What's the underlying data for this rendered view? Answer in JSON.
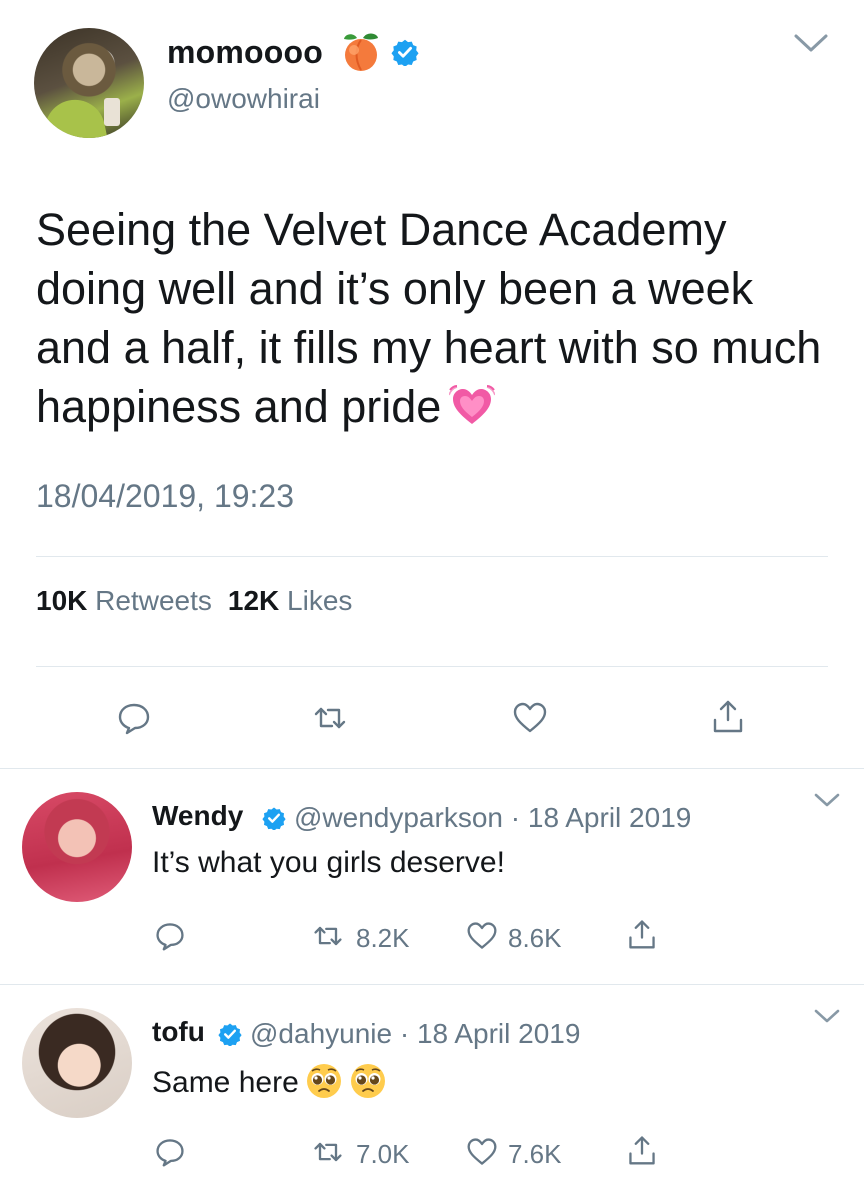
{
  "main_tweet": {
    "display_name": "momoooo",
    "name_emoji": "peach-emoji",
    "handle": "@owowhirai",
    "text": "Seeing the Velvet Dance Academy doing well and it’s only been a week and a half, it fills my heart with so much happiness and pride",
    "text_emoji": "growing-heart-emoji",
    "timestamp": "18/04/2019, 19:23",
    "retweets_count": "10K",
    "retweets_label": "Retweets",
    "likes_count": "12K",
    "likes_label": "Likes",
    "actions": [
      "reply-icon",
      "retweet-icon",
      "like-icon",
      "share-icon"
    ]
  },
  "replies": [
    {
      "display_name": "Wendy",
      "handle": "@wendyparkson",
      "separator": "·",
      "date": "18 April 2019",
      "text": "It’s what you girls deserve!",
      "retweets": "8.2K",
      "likes": "8.6K"
    },
    {
      "display_name": "tofu",
      "handle": "@dahyunie",
      "separator": "·",
      "date": "18 April 2019",
      "text": "Same here",
      "text_emoji": "pleading-face-emoji",
      "retweets": "7.0K",
      "likes": "7.6K"
    }
  ],
  "colors": {
    "text_primary": "#14171a",
    "text_secondary": "#657786",
    "divider": "#e1e8ed",
    "verified": "#1da1f2",
    "heart_pink": "#f15aa5"
  }
}
